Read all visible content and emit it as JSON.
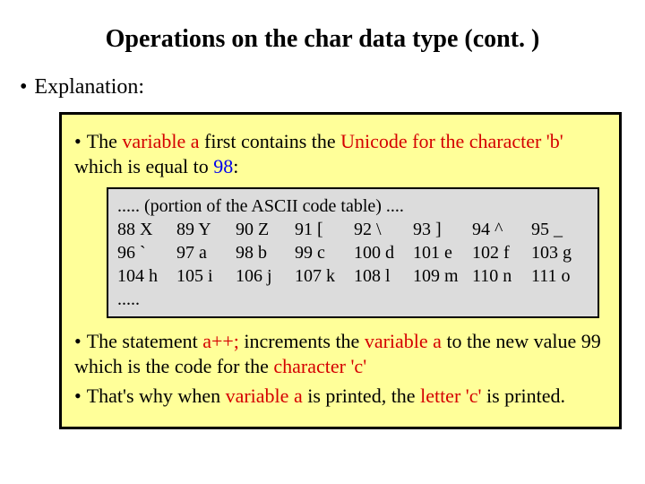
{
  "title": "Operations on the char data type (cont. )",
  "lead_bullet": "•",
  "lead_text": "Explanation:",
  "box": {
    "p1": {
      "bullet": "•",
      "t1": "The ",
      "t2": "variable a",
      "t3": " first contains the ",
      "t4": "Unicode for the character 'b'",
      "t5": " which is equal to ",
      "t6": "98",
      "t7": ":"
    },
    "code": {
      "l1": "..... (portion of the ASCII code table) ....",
      "l2": [
        {
          "k": "88",
          "v": "X"
        },
        {
          "k": "89",
          "v": "Y"
        },
        {
          "k": "90",
          "v": "Z"
        },
        {
          "k": "91",
          "v": "["
        },
        {
          "k": "92",
          "v": "\\"
        },
        {
          "k": "93",
          "v": "]"
        },
        {
          "k": "94",
          "v": "^"
        },
        {
          "k": "95",
          "v": "_"
        }
      ],
      "l3": [
        {
          "k": "96",
          "v": "`"
        },
        {
          "k": "97",
          "v": "a"
        },
        {
          "k": "98",
          "v": "b"
        },
        {
          "k": "99",
          "v": "c"
        },
        {
          "k": "100",
          "v": "d"
        },
        {
          "k": "101",
          "v": "e"
        },
        {
          "k": "102",
          "v": "f"
        },
        {
          "k": "103",
          "v": "g"
        }
      ],
      "l4": [
        {
          "k": "104",
          "v": "h"
        },
        {
          "k": "105",
          "v": "i"
        },
        {
          "k": "106",
          "v": "j"
        },
        {
          "k": "107",
          "v": "k"
        },
        {
          "k": "108",
          "v": "l"
        },
        {
          "k": "109",
          "v": "m"
        },
        {
          "k": "110",
          "v": "n"
        },
        {
          "k": "111",
          "v": "o"
        }
      ],
      "l5": "....."
    },
    "p2": {
      "bullet": "•",
      "t1": "The statement ",
      "t2": "a++;",
      "t3": " increments the ",
      "t4": "variable a",
      "t5": " to the new value 99 which is the code for the ",
      "t6": "character 'c'"
    },
    "p3": {
      "bullet": "•",
      "t1": "That's why when ",
      "t2": "variable a",
      "t3": " is printed, the ",
      "t4": "letter 'c'",
      "t5": " is printed."
    }
  }
}
